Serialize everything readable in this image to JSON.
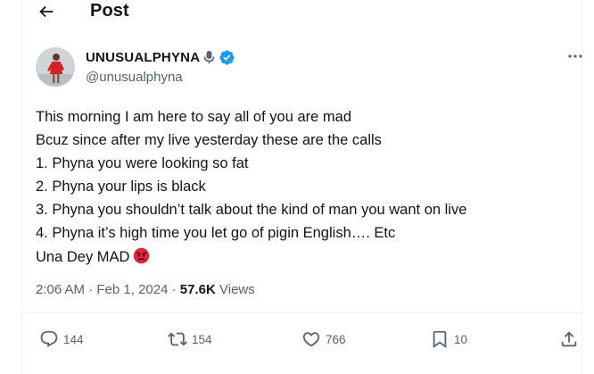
{
  "header": {
    "title": "Post"
  },
  "author": {
    "display_name": "UNUSUALPHYNA",
    "handle": "@unusualphyna",
    "verified": true
  },
  "tweet": {
    "lines": [
      "This morning I am here to say all of you are mad",
      "Bcuz since after my live yesterday these are the calls",
      "1. Phyna you were looking so fat",
      "2. Phyna your lips is black",
      "3. Phyna you shouldn’t talk about the kind of man you want on live",
      "4. Phyna it’s high time you let go of pigin English…. Etc",
      "Una Dey MAD"
    ],
    "emoji_icon": "angry-face-icon"
  },
  "meta": {
    "time": "2:06 AM",
    "separator": " · ",
    "date": "Feb 1, 2024",
    "views_count": "57.6K",
    "views_label": "Views"
  },
  "actions": {
    "replies": "144",
    "reposts": "154",
    "likes": "766",
    "bookmarks": "10"
  },
  "colors": {
    "text": "#0f1419",
    "secondary": "#536471",
    "verified": "#1d9bf0",
    "divider": "#eff3f4"
  }
}
